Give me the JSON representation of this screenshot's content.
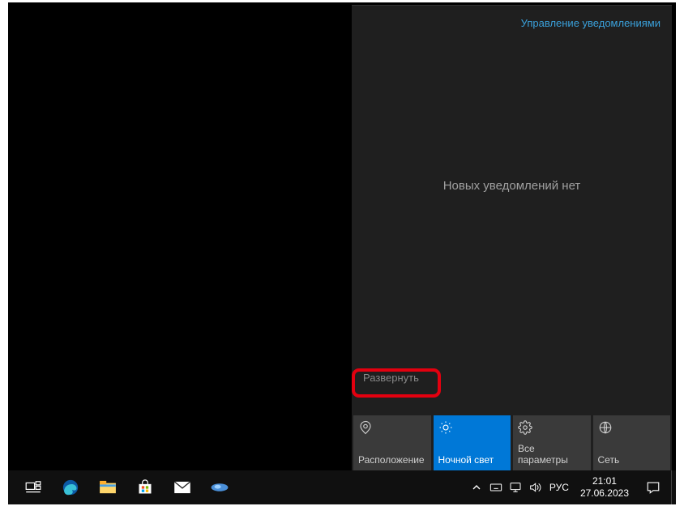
{
  "action_center": {
    "manage_link": "Управление уведомлениями",
    "empty_text": "Новых уведомлений нет",
    "expand_label": "Развернуть",
    "tiles": [
      {
        "id": "location",
        "label": "Расположение",
        "active": false,
        "icon": "location-icon"
      },
      {
        "id": "night-light",
        "label": "Ночной свет",
        "active": true,
        "icon": "sun-icon"
      },
      {
        "id": "settings",
        "label": "Все параметры",
        "active": false,
        "icon": "gear-icon"
      },
      {
        "id": "network",
        "label": "Сеть",
        "active": false,
        "icon": "network-icon"
      }
    ]
  },
  "taskbar": {
    "pinned": [
      {
        "id": "task-view",
        "name": "task-view-icon"
      },
      {
        "id": "edge",
        "name": "edge-icon"
      },
      {
        "id": "explorer",
        "name": "file-explorer-icon"
      },
      {
        "id": "store",
        "name": "store-icon"
      },
      {
        "id": "mail",
        "name": "mail-icon"
      },
      {
        "id": "paint3d",
        "name": "paint3d-icon"
      }
    ],
    "tray": {
      "language": "РУС",
      "time": "21:01",
      "date": "27.06.2023"
    }
  }
}
